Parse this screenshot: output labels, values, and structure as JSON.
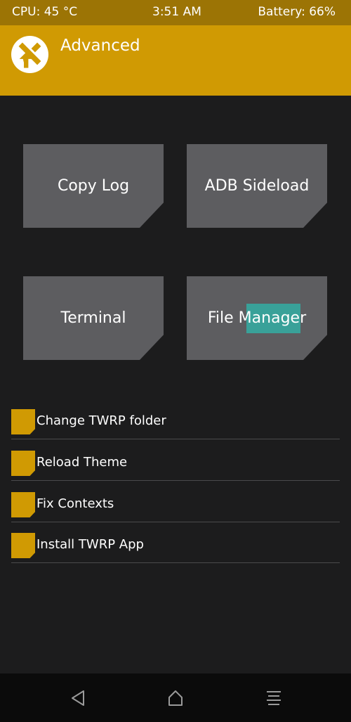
{
  "status_bar": {
    "cpu": "CPU: 45 °C",
    "time": "3:51 AM",
    "battery": "Battery: 66%"
  },
  "header": {
    "title": "Advanced",
    "logo_icon": "twrp-logo-icon"
  },
  "tiles": [
    {
      "label": "Copy Log"
    },
    {
      "label": "ADB Sideload"
    },
    {
      "label": "Terminal"
    },
    {
      "label": "File Manager"
    }
  ],
  "options": [
    {
      "label": "Change TWRP folder"
    },
    {
      "label": "Reload Theme"
    },
    {
      "label": "Fix Contexts"
    },
    {
      "label": "Install TWRP App"
    }
  ],
  "nav": {
    "icons": [
      "back-icon",
      "home-icon",
      "menu-icon"
    ]
  },
  "colors": {
    "accent": "#d09a03",
    "status_bar": "#9c7405",
    "background": "#1c1c1d",
    "tile": "#5d5d60",
    "touch_highlight": "#2eb8ac"
  }
}
